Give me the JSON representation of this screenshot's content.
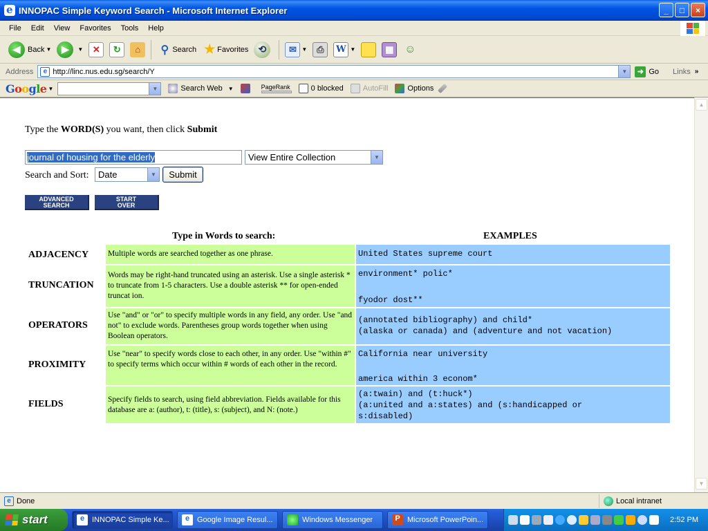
{
  "window": {
    "title": "INNOPAC Simple Keyword Search - Microsoft Internet Explorer",
    "controls": [
      "_",
      "□",
      "×"
    ]
  },
  "menu": [
    "File",
    "Edit",
    "View",
    "Favorites",
    "Tools",
    "Help"
  ],
  "toolbar": {
    "back": "Back",
    "search": "Search",
    "favorites": "Favorites"
  },
  "address": {
    "label": "Address",
    "url": "http://linc.nus.edu.sg/search/Y",
    "go": "Go",
    "links": "Links"
  },
  "googlebar": {
    "logo": "Google",
    "search_web": "Search Web",
    "pagerank": "PageRank",
    "blocked": "0 blocked",
    "autofill": "AutoFill",
    "options": "Options"
  },
  "page": {
    "instruction_pre": "Type the ",
    "instruction_word": "WORD(S)",
    "instruction_mid": " you want, then click ",
    "instruction_submit": "Submit",
    "search_value": "journal of housing for the elderly",
    "collection_value": "View Entire Collection",
    "sort_label": "Search and Sort:",
    "sort_value": "Date",
    "submit": "Submit",
    "advanced_button": [
      "Advanced",
      "Search"
    ],
    "startover_button": [
      "Start",
      "Over"
    ],
    "col_type_header": "Type in Words to search:",
    "col_examples_header": "EXAMPLES",
    "rows": [
      {
        "label": "ADJACENCY",
        "desc": "Multiple words are searched together as one phrase.",
        "example": "United States supreme court"
      },
      {
        "label": "TRUNCATION",
        "desc": "Words may be right-hand truncated using an asterisk. Use a single asterisk * to truncate from 1-5 characters. Use a double asterisk ** for open-ended truncat ion.",
        "example": "environment* polic*\n\nfyodor dost**"
      },
      {
        "label": "OPERATORS",
        "desc": "Use \"and\" or \"or\" to specify multiple words in any field, any order. Use \"and not\" to exclude words. Parentheses group words together when using Boolean operators.",
        "example": "(annotated bibliography) and child*\n(alaska or canada) and (adventure and not vacation)"
      },
      {
        "label": "PROXIMITY",
        "desc": "Use \"near\" to specify words close to each other, in any order. Use \"within #\" to specify terms which occur within # words of each other in the record.",
        "example": "California near university\n\namerica within 3 econom*"
      },
      {
        "label": "FIELDS",
        "desc": "Specify fields to search, using field abbreviation. Fields available for this database are a: (author), t: (title), s: (subject), and N: (note.)",
        "example": "(a:twain) and (t:huck*)\n(a:united and a:states) and (s:handicapped or\ns:disabled)"
      }
    ]
  },
  "status": {
    "text": "Done",
    "zone": "Local intranet"
  },
  "taskbar": {
    "start": "start",
    "tasks": [
      "INNOPAC Simple Ke...",
      "Google Image Resul...",
      "Windows Messenger",
      "Microsoft PowerPoin..."
    ],
    "clock": "2:52 PM"
  },
  "colors": {
    "desc_cell": "#ccff99",
    "example_cell": "#99ccff",
    "image_button": "#2a4280"
  }
}
